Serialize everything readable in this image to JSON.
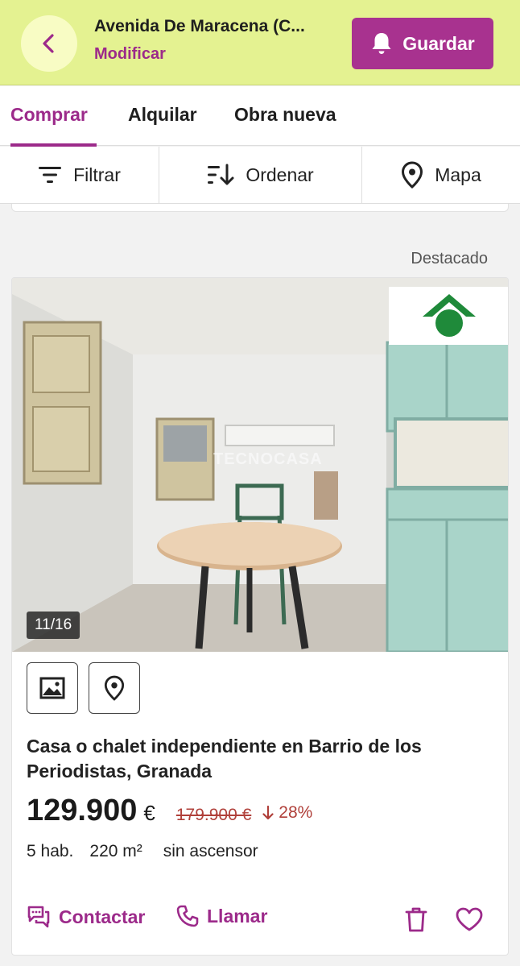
{
  "header": {
    "title": "Avenida De Maracena (C...",
    "modify_label": "Modificar",
    "save_label": "Guardar"
  },
  "tabs": [
    {
      "label": "Comprar",
      "active": true
    },
    {
      "label": "Alquilar",
      "active": false
    },
    {
      "label": "Obra nueva",
      "active": false
    }
  ],
  "toolbar": {
    "filter_label": "Filtrar",
    "sort_label": "Ordenar",
    "map_label": "Mapa"
  },
  "featured_label": "Destacado",
  "listing": {
    "photo_counter": "11/16",
    "watermark": "TECNOCASA",
    "title": "Casa o chalet independiente en Barrio de los Periodistas, Granada",
    "price": "129.900",
    "currency": "€",
    "old_price": "179.900 €",
    "drop_percent": "28%",
    "features": [
      "5 hab.",
      "220 m²",
      "sin ascensor"
    ],
    "contact_label": "Contactar",
    "call_label": "Llamar"
  },
  "colors": {
    "header_bg": "#e4f291",
    "accent": "#9c2a8a",
    "button_bg": "#a8328f",
    "price_drop": "#b0403a",
    "agency_logo": "#1f8a3a"
  },
  "icons": [
    "chevron-left-icon",
    "bell-icon",
    "filter-icon",
    "sort-icon",
    "map-pin-icon",
    "image-icon",
    "location-icon",
    "chat-icon",
    "phone-icon",
    "trash-icon",
    "heart-icon",
    "arrow-down-icon"
  ]
}
